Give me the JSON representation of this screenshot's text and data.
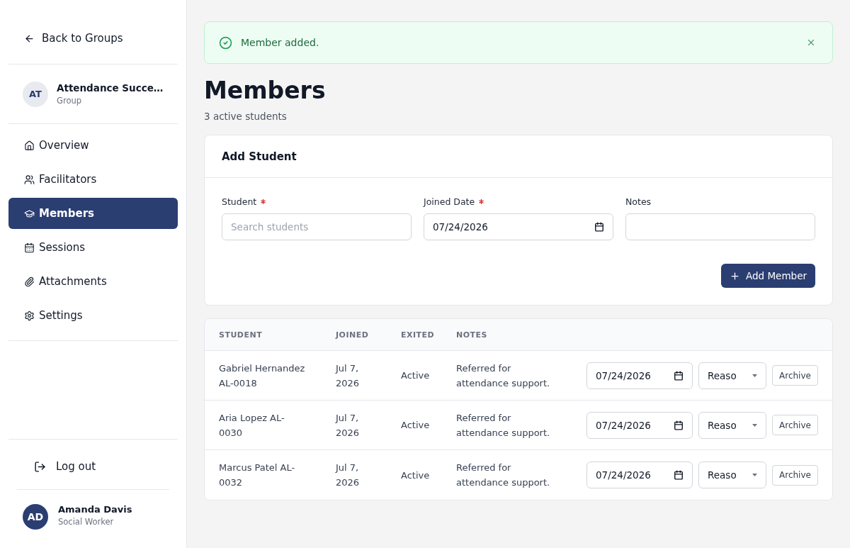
{
  "sidebar": {
    "back_link": "Back to Groups",
    "group": {
      "initials": "AT",
      "name": "Attendance Succe…",
      "type": "Group"
    },
    "nav": [
      {
        "label": "Overview",
        "selected": false
      },
      {
        "label": "Facilitators",
        "selected": false
      },
      {
        "label": "Members",
        "selected": true
      },
      {
        "label": "Sessions",
        "selected": false
      },
      {
        "label": "Attachments",
        "selected": false
      },
      {
        "label": "Settings",
        "selected": false
      }
    ],
    "logout": "Log out",
    "user": {
      "initials": "AD",
      "name": "Amanda Davis",
      "role": "Social Worker"
    }
  },
  "alert": {
    "message": "Member added."
  },
  "page": {
    "title": "Members",
    "subtitle": "3 active students"
  },
  "add_form": {
    "title": "Add Student",
    "fields": [
      {
        "kind": "text",
        "label": "Student",
        "required": true,
        "placeholder": "Search students"
      },
      {
        "kind": "date",
        "label": "Joined Date",
        "required": true,
        "value": "07/24/2026"
      },
      {
        "kind": "text",
        "label": "Notes",
        "required": false
      }
    ],
    "submit": "Add Member"
  },
  "table": {
    "columns": [
      "STUDENT",
      "JOINED",
      "EXITED",
      "NOTES"
    ],
    "rows": [
      {
        "student": "Gabriel Hernandez AL-0018",
        "joined": "Jul 7, 2026",
        "exited": "Active",
        "notes": "Referred for attendance support.",
        "exit_date": "07/24/2026",
        "reason": "Reaso",
        "action": "Archive"
      },
      {
        "student": "Aria Lopez AL-0030",
        "joined": "Jul 7, 2026",
        "exited": "Active",
        "notes": "Referred for attendance support.",
        "exit_date": "07/24/2026",
        "reason": "Reaso",
        "action": "Archive"
      },
      {
        "student": "Marcus Patel AL-0032",
        "joined": "Jul 7, 2026",
        "exited": "Active",
        "notes": "Referred for attendance support.",
        "exit_date": "07/24/2026",
        "reason": "Reaso",
        "action": "Archive"
      }
    ]
  }
}
